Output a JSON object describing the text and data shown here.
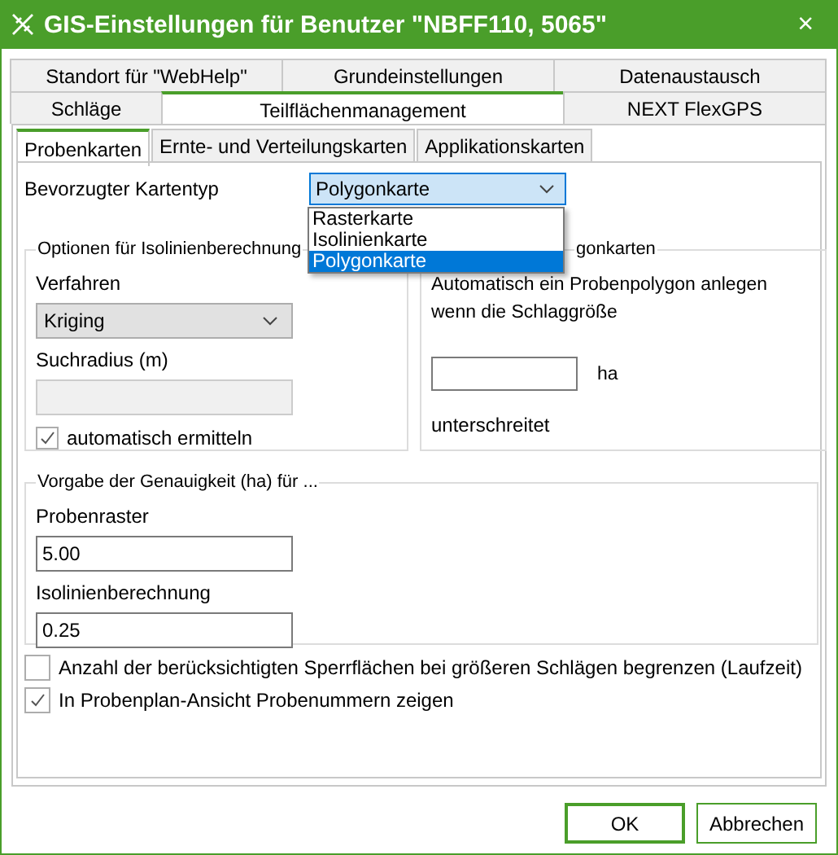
{
  "window": {
    "title": "GIS-Einstellungen für Benutzer \"NBFF110, 5065\"",
    "close": "×"
  },
  "tabs_row_1": [
    {
      "label": "Standort für \"WebHelp\"",
      "selected": false
    },
    {
      "label": "Grundeinstellungen",
      "selected": false
    },
    {
      "label": "Datenaustausch",
      "selected": false
    }
  ],
  "tabs_row_2": [
    {
      "label": "Schläge",
      "selected": false
    },
    {
      "label": "Teilflächenmanagement",
      "selected": true
    },
    {
      "label": "NEXT FlexGPS",
      "selected": false
    }
  ],
  "subtabs": [
    {
      "label": "Probenkarten",
      "selected": true
    },
    {
      "label": "Ernte- und Verteilungskarten",
      "selected": false
    },
    {
      "label": "Applikationskarten",
      "selected": false
    }
  ],
  "preferred_map_type": {
    "label": "Bevorzugter Kartentyp",
    "value": "Polygonkarte",
    "expanded": true,
    "options": [
      {
        "label": "Rasterkarte",
        "selected": false
      },
      {
        "label": "Isolinienkarte",
        "selected": false
      },
      {
        "label": "Polygonkarte",
        "selected": true
      }
    ]
  },
  "isoline_group": {
    "title": "Optionen für Isolinienberechnung",
    "method_label": "Verfahren",
    "method_value": "Kriging",
    "radius_label": "Suchradius (m)",
    "radius_disabled": true,
    "auto": {
      "label": "automatisch ermitteln",
      "checked": true
    }
  },
  "polygon_group": {
    "title": "gonkarten",
    "text": "Automatisch ein Probenpolygon anlegen wenn die Schlaggröße",
    "unit": "ha",
    "suffix": "unterschreitet"
  },
  "accuracy_group": {
    "title": "Vorgabe der Genauigkeit (ha) für ...",
    "fields": [
      {
        "label": "Probenraster",
        "value": "5.00"
      },
      {
        "label": "Isolinienberechnung",
        "value": "0.25"
      }
    ]
  },
  "options": [
    {
      "label": "Anzahl der berücksichtigten Sperrflächen bei größeren Schlägen begrenzen (Laufzeit)",
      "checked": false
    },
    {
      "label": "In Probenplan-Ansicht Probenummern zeigen",
      "checked": true
    }
  ],
  "buttons": [
    {
      "label": "OK",
      "default": true
    },
    {
      "label": "Abbrechen",
      "default": false
    }
  ]
}
